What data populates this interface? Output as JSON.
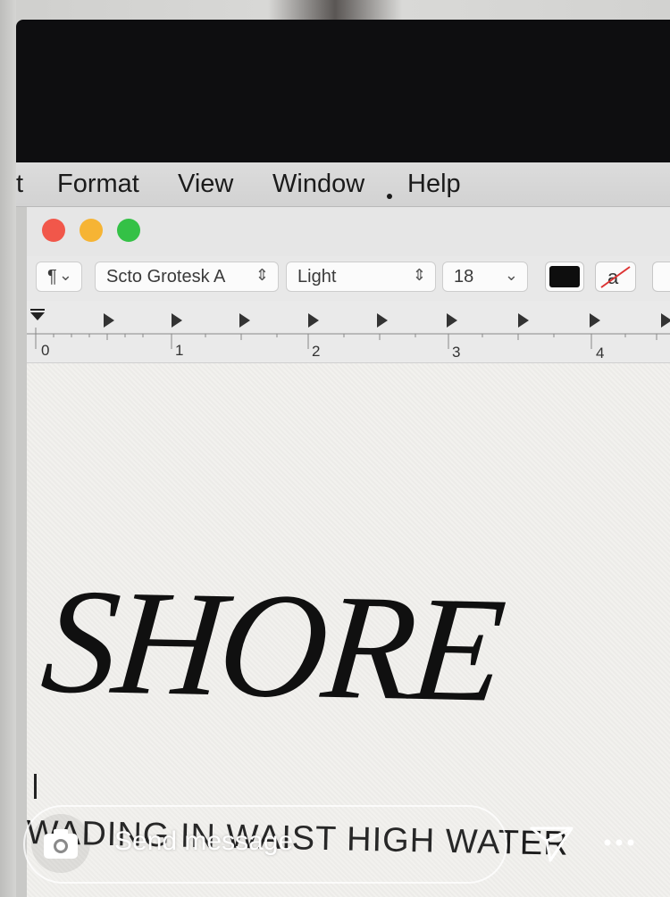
{
  "menubar": {
    "items": [
      "t",
      "Format",
      "View",
      "Window",
      "Help"
    ]
  },
  "toolbar": {
    "paragraph_style": "¶",
    "font_family": "Scto Grotesk A",
    "font_style": "Light",
    "font_size": "18",
    "text_color": "#0e0e0e"
  },
  "ruler": {
    "labels": [
      "0",
      "1",
      "2",
      "3",
      "4"
    ]
  },
  "document": {
    "headline": "SHORE",
    "subline": "WADING IN WAIST HIGH WATER"
  },
  "message_bar": {
    "placeholder": "Send message"
  },
  "colors": {
    "close": "#f1574a",
    "minimize": "#f6b434",
    "zoom": "#34c146"
  }
}
